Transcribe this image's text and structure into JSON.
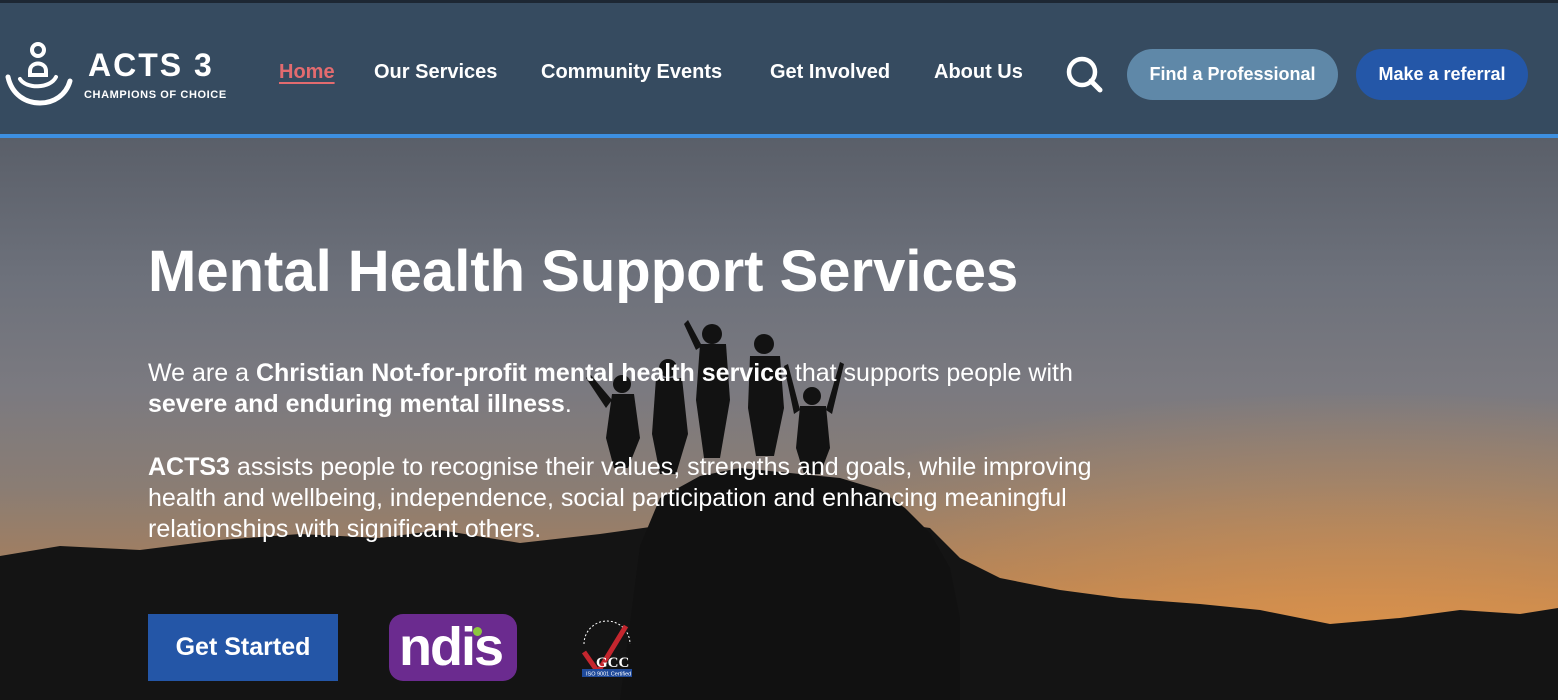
{
  "header": {
    "logo": {
      "title": "ACTS 3",
      "subtitle": "CHAMPIONS OF CHOICE",
      "icon": "hands-cup-logo-icon"
    },
    "nav": [
      {
        "label": "Home",
        "active": true
      },
      {
        "label": "Our Services",
        "active": false
      },
      {
        "label": "Community Events",
        "active": false
      },
      {
        "label": "Get Involved",
        "active": false
      },
      {
        "label": "About Us",
        "active": false
      }
    ],
    "search_icon": "search-icon",
    "find_professional": "Find a Professional",
    "make_referral": "Make a referral"
  },
  "hero": {
    "title": "Mental Health Support Services",
    "p1": {
      "t1": "We are a ",
      "b1": "Christian Not-for-profit mental health service",
      "t2": " that supports people with ",
      "b2": "severe and enduring mental illness",
      "t3": "."
    },
    "p2": {
      "b1": "ACTS3",
      "t1": " assists people to recognise their values, strengths and goals, while improving health and wellbeing, independence, social participation and enhancing meaningful relationships with significant others."
    },
    "cta": "Get Started",
    "ndis_logo": "ndis",
    "gcc_logo": {
      "text": "GCC",
      "caption": "ISO 9001 Certified"
    }
  },
  "colors": {
    "header_bg": "#364b60",
    "active_nav": "#e36b6f",
    "primary_button": "#2457a8",
    "secondary_button": "#5f88a8",
    "ndis_purple": "#6b2b8f"
  }
}
